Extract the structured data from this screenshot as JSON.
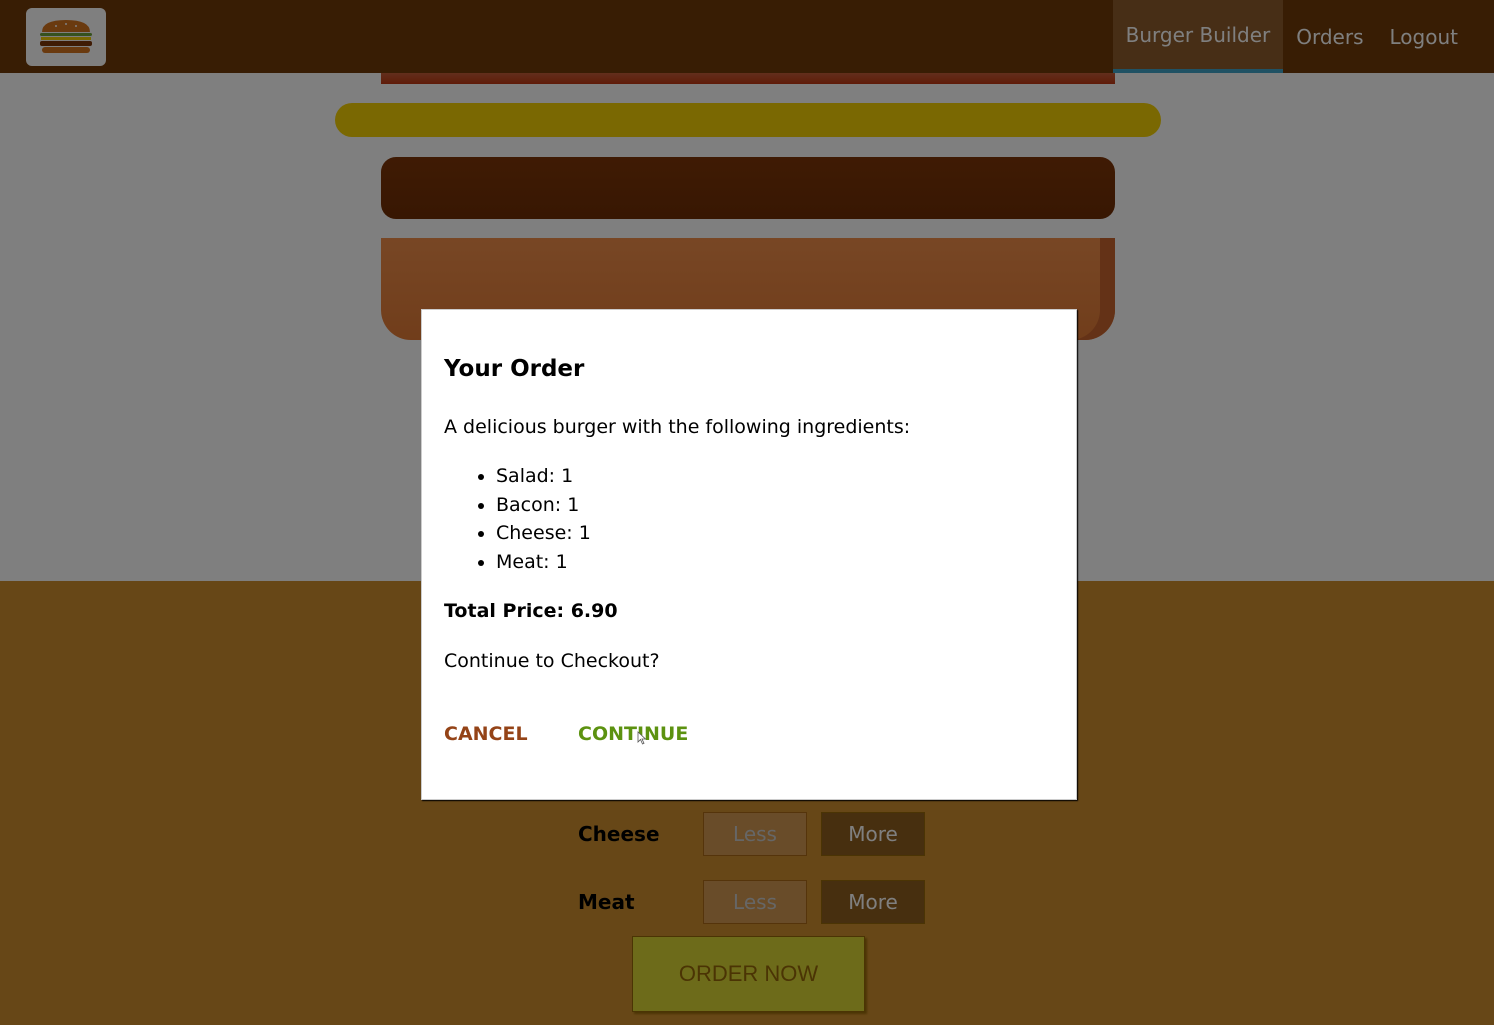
{
  "colors": {
    "toolbar": "#703b09",
    "nav_active_underline": "#40a4c8",
    "controls_bg": "#cf8f2e",
    "cancel": "#944317",
    "continue": "#5c9210",
    "order_button": "#dad735"
  },
  "toolbar": {
    "logo_icon": "burger-logo-icon",
    "nav": [
      {
        "label": "Burger Builder",
        "active": true
      },
      {
        "label": "Orders",
        "active": false
      },
      {
        "label": "Logout",
        "active": false
      }
    ]
  },
  "burger": {
    "layers": [
      "bacon",
      "cheese",
      "meat",
      "bread-bottom"
    ]
  },
  "controls": [
    {
      "label": "Cheese",
      "less": "Less",
      "more": "More"
    },
    {
      "label": "Meat",
      "less": "Less",
      "more": "More"
    }
  ],
  "order_button_label": "ORDER NOW",
  "modal": {
    "title": "Your Order",
    "intro": "A delicious burger with the following ingredients:",
    "ingredients": [
      {
        "text": "Salad: 1"
      },
      {
        "text": "Bacon: 1"
      },
      {
        "text": "Cheese: 1"
      },
      {
        "text": "Meat: 1"
      }
    ],
    "total_price": "Total Price: 6.90",
    "question": "Continue to Checkout?",
    "cancel_label": "CANCEL",
    "continue_label": "CONTINUE"
  }
}
